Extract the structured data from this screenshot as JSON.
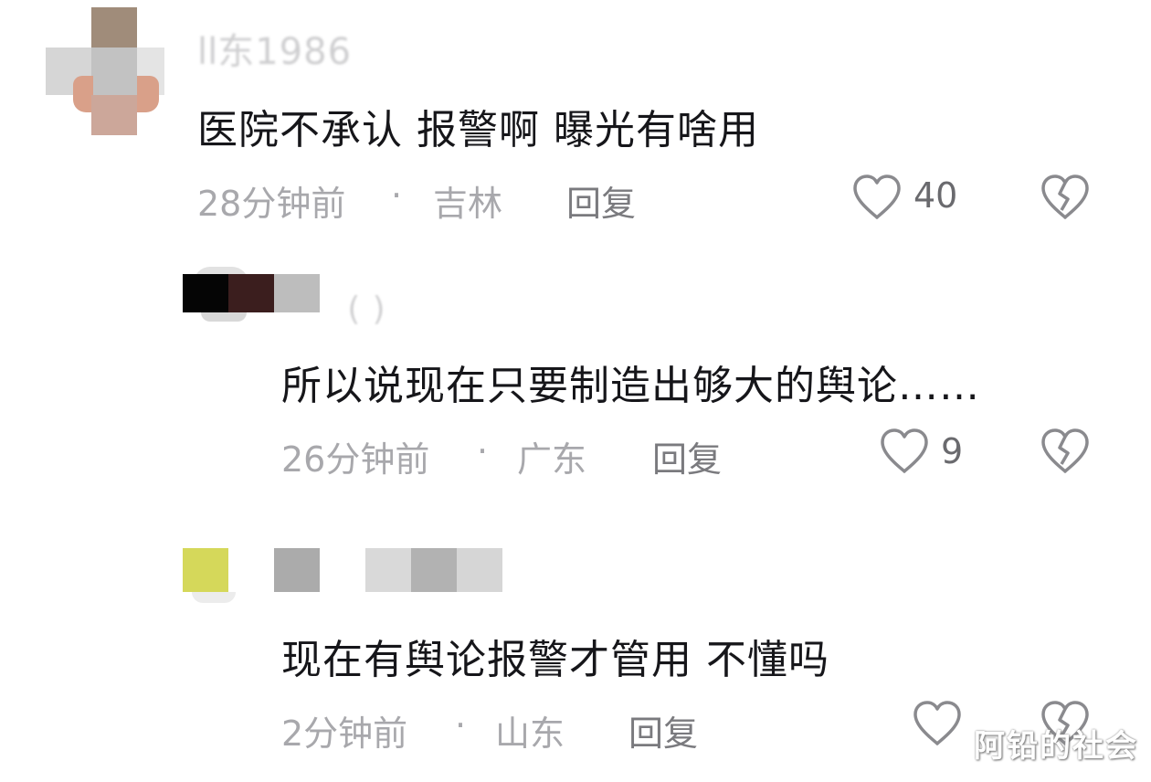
{
  "comments": [
    {
      "username": "ﺍﺍ东1986",
      "text": "医院不承认  报警啊  曝光有啥用",
      "time": "28分钟前",
      "location": "吉林",
      "reply_label": "回复",
      "likes": "40"
    },
    {
      "username": " (  )",
      "text": "所以说现在只要制造出够大的舆论……",
      "time": "26分钟前",
      "location": "广东",
      "reply_label": "回复",
      "likes": "9"
    },
    {
      "username": "",
      "text": "现在有舆论报警才管用 不懂吗",
      "time": "2分钟前",
      "location": "山东",
      "reply_label": "回复",
      "likes": ""
    }
  ],
  "separator": "·",
  "icons": {
    "like": "heart-outline-icon",
    "dislike": "broken-heart-icon"
  },
  "watermark": "阿铅的社会",
  "colors": {
    "text": "#16161a",
    "meta": "#a8a8ac",
    "reply": "#7a7a7e",
    "icon": "#8a8a8e"
  }
}
